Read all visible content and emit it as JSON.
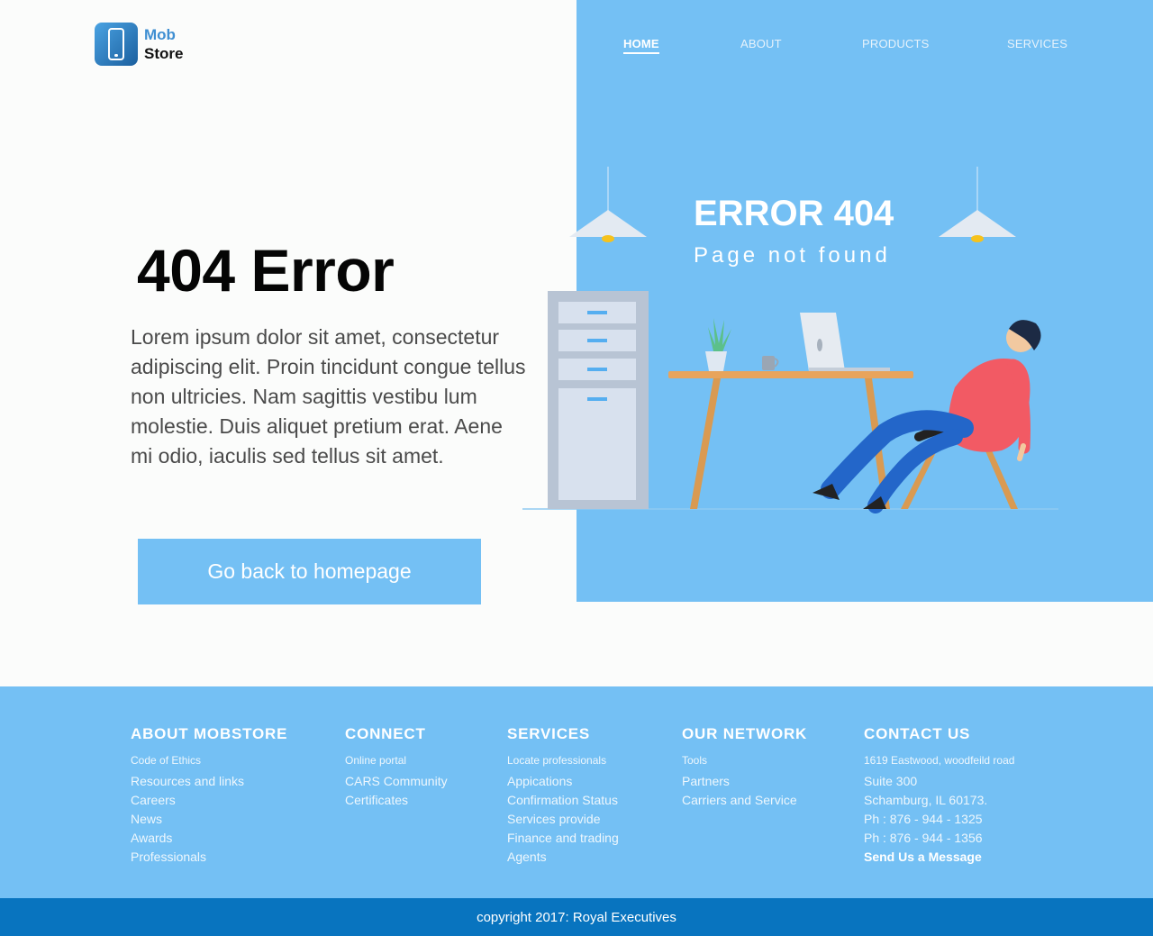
{
  "brand": {
    "line1": "Mob",
    "line2": "Store"
  },
  "nav": [
    {
      "label": "HOME",
      "active": true
    },
    {
      "label": "ABOUT",
      "active": false
    },
    {
      "label": "PRODUCTS",
      "active": false
    },
    {
      "label": "SERVICES",
      "active": false
    }
  ],
  "hero": {
    "heading": "404 Error",
    "paragraph": "Lorem ipsum dolor sit amet, consectetur adipiscing elit. Proin tincidunt congue tellus non ultricies. Nam sagittis vestibu lum molestie. Duis aliquet pretium erat. Aene mi odio, iaculis sed tellus sit amet.",
    "button": "Go back to homepage"
  },
  "panel": {
    "title": "ERROR 404",
    "subtitle": "Page not found"
  },
  "footer": {
    "columns": [
      {
        "title": "ABOUT MOBSTORE",
        "first": "Code of Ethics",
        "items": [
          "Resources and links",
          "Careers",
          "News",
          "Awards",
          "Professionals"
        ]
      },
      {
        "title": "CONNECT",
        "first": "Online portal",
        "items": [
          "CARS Community",
          "Certificates"
        ]
      },
      {
        "title": "SERVICES",
        "first": "Locate professionals",
        "items": [
          "Appications",
          "Confirmation Status",
          "Services provide",
          "Finance and trading",
          "Agents"
        ]
      },
      {
        "title": "OUR NETWORK",
        "first": "Tools",
        "items": [
          "Partners",
          "Carriers and Service"
        ]
      },
      {
        "title": "CONTACT US",
        "first": "1619 Eastwood, woodfeild road",
        "items": [
          "Suite 300",
          "Schamburg, IL 60173.",
          "Ph : 876 - 944 - 1325",
          "Ph : 876 - 944 - 1356"
        ],
        "cta": "Send Us a Message"
      }
    ],
    "copyright": "copyright 2017: Royal Executives"
  },
  "colors": {
    "accent": "#74c0f4",
    "footer_bar": "#0874bf",
    "shirt": "#f25a64",
    "pants": "#2366c9",
    "desk": "#e8a45c"
  },
  "icons": {
    "logo": "smartphone-icon"
  }
}
